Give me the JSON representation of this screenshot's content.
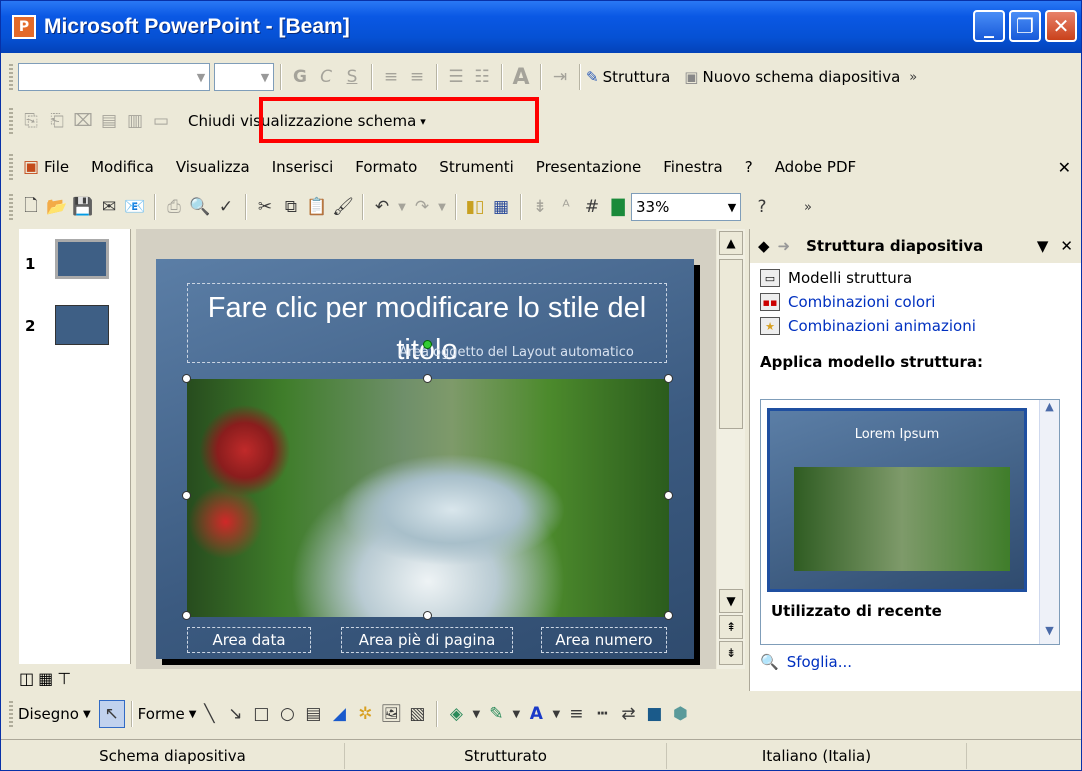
{
  "window": {
    "title": "Microsoft PowerPoint - [Beam]",
    "app_icon": "powerpoint-icon"
  },
  "format_toolbar": {
    "bold": "G",
    "italic": "C",
    "shadow": "S",
    "structure_label": "Struttura",
    "new_master_label": "Nuovo schema diapositiva"
  },
  "master_toolbar": {
    "close_label": "Chiudi visualizzazione schema"
  },
  "menu": {
    "items": [
      "File",
      "Modifica",
      "Visualizza",
      "Inserisci",
      "Formato",
      "Strumenti",
      "Presentazione",
      "Finestra",
      "?",
      "Adobe PDF"
    ]
  },
  "standard_toolbar": {
    "zoom": "33%"
  },
  "thumbnails": {
    "items": [
      {
        "number": "1"
      },
      {
        "number": "2"
      }
    ]
  },
  "slide": {
    "title": "Fare clic per modificare lo stile del titolo",
    "subtitle": "Area oggetto del Layout automatico",
    "footer_date": "Area data",
    "footer_footer": "Area piè di pagina",
    "footer_number": "Area numero"
  },
  "task_pane": {
    "title": "Struttura diapositiva",
    "links": [
      "Modelli struttura",
      "Combinazioni colori",
      "Combinazioni animazioni"
    ],
    "apply_heading": "Applica modello struttura:",
    "template_title": "Lorem Ipsum",
    "recent_heading": "Utilizzato di recente",
    "browse_label": "Sfoglia..."
  },
  "drawing_toolbar": {
    "draw_label": "Disegno",
    "shapes_label": "Forme"
  },
  "status_bar": {
    "view": "Schema diapositiva",
    "design": "Strutturato",
    "language": "Italiano (Italia)"
  },
  "colors": {
    "title_bar": "#0651d4",
    "highlight_border": "#ff0000",
    "slide_bg": "#3e5f85"
  }
}
